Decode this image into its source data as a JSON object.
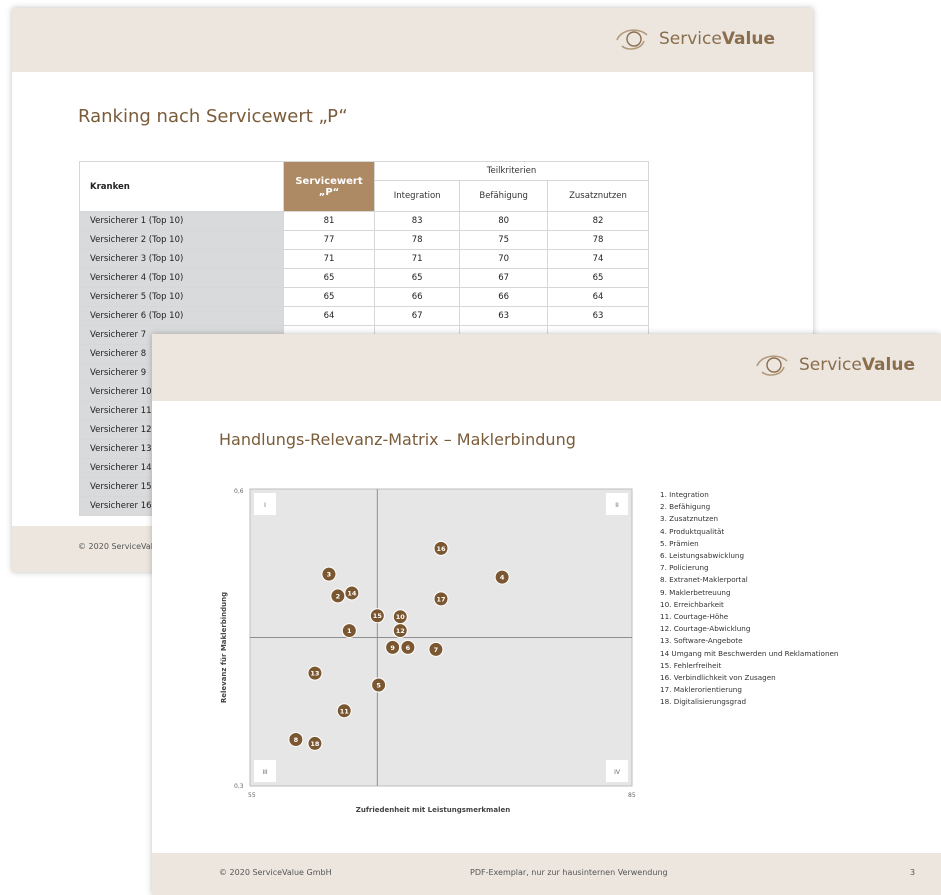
{
  "brand": {
    "name_light": "Service",
    "name_bold": "Value",
    "accent": "#ad8a63",
    "header_bg": "#ece6df",
    "row_bg": "#d9dadc",
    "matrix_bg": "#e6e6e6",
    "bubble": "#7a5730"
  },
  "slide1": {
    "title": "Ranking nach Servicewert „P“",
    "table": {
      "col_kranken": "Kranken",
      "col_servicewert": "Servicewert „P“",
      "col_teilkriterien": "Teilkriterien",
      "sub_cols": [
        "Integration",
        "Befähigung",
        "Zusatznutzen"
      ],
      "rows": [
        {
          "name": "Versicherer 1 (Top 10)",
          "values": [
            "81",
            "83",
            "80",
            "82"
          ]
        },
        {
          "name": "Versicherer 2 (Top 10)",
          "values": [
            "77",
            "78",
            "75",
            "78"
          ]
        },
        {
          "name": "Versicherer 3 (Top 10)",
          "values": [
            "71",
            "71",
            "70",
            "74"
          ]
        },
        {
          "name": "Versicherer 4 (Top 10)",
          "values": [
            "65",
            "65",
            "67",
            "65"
          ]
        },
        {
          "name": "Versicherer 5 (Top 10)",
          "values": [
            "65",
            "66",
            "66",
            "64"
          ]
        },
        {
          "name": "Versicherer 6 (Top 10)",
          "values": [
            "64",
            "67",
            "63",
            "63"
          ]
        },
        {
          "name": "Versicherer 7",
          "values": [
            "",
            "",
            "",
            ""
          ]
        },
        {
          "name": "Versicherer 8",
          "values": [
            "",
            "",
            "",
            ""
          ]
        },
        {
          "name": "Versicherer 9",
          "values": [
            "",
            "",
            "",
            ""
          ]
        },
        {
          "name": "Versicherer 10",
          "values": [
            "",
            "",
            "",
            ""
          ]
        },
        {
          "name": "Versicherer 11",
          "values": [
            "",
            "",
            "",
            ""
          ]
        },
        {
          "name": "Versicherer 12",
          "values": [
            "",
            "",
            "",
            ""
          ]
        },
        {
          "name": "Versicherer 13",
          "values": [
            "",
            "",
            "",
            ""
          ]
        },
        {
          "name": "Versicherer 14",
          "values": [
            "",
            "",
            "",
            ""
          ]
        },
        {
          "name": "Versicherer 15",
          "values": [
            "",
            "",
            "",
            ""
          ]
        },
        {
          "name": "Versicherer 16",
          "values": [
            "",
            "",
            "",
            ""
          ]
        }
      ]
    },
    "footer": "© 2020 ServiceVal"
  },
  "slide2": {
    "title": "Handlungs-Relevanz-Matrix  –  Maklerbindung",
    "footer_left": "© 2020 ServiceValue GmbH",
    "footer_center": "PDF-Exemplar, nur zur hausinternen Verwendung",
    "page_number": "3",
    "legend": [
      "1. Integration",
      "2. Befähigung",
      "3. Zusatznutzen",
      "4. Produktqualität",
      "5. Prämien",
      "6. Leistungsabwicklung",
      "7. Policierung",
      "8. Extranet-Maklerportal",
      "9. Maklerbetreuung",
      "10. Erreichbarkeit",
      "11. Courtage-Höhe",
      "12. Courtage-Abwicklung",
      "13. Software-Angebote",
      "14 Umgang mit Beschwerden und Reklamationen",
      "15. Fehlerfreiheit",
      "16. Verbindlichkeit von Zusagen",
      "17. Maklerorientierung",
      "18. Digitalisierungsgrad"
    ]
  },
  "chart_data": {
    "type": "scatter",
    "xlabel": "Zufriedenheit mit Leistungsmerkmalen",
    "ylabel": "Relevanz für Maklerbindung",
    "xlim": [
      55,
      85
    ],
    "ylim": [
      0.3,
      0.6
    ],
    "x_ticks": [
      "55",
      "85"
    ],
    "y_ticks": [
      "0,3",
      "0,6"
    ],
    "quadrants": [
      "I",
      "II",
      "III",
      "IV"
    ],
    "grid": false,
    "points": [
      {
        "label": "1",
        "x": 62.8,
        "y": 0.457
      },
      {
        "label": "2",
        "x": 61.9,
        "y": 0.492
      },
      {
        "label": "3",
        "x": 61.2,
        "y": 0.514
      },
      {
        "label": "4",
        "x": 74.8,
        "y": 0.511
      },
      {
        "label": "5",
        "x": 65.1,
        "y": 0.402
      },
      {
        "label": "6",
        "x": 67.4,
        "y": 0.44
      },
      {
        "label": "7",
        "x": 69.6,
        "y": 0.438
      },
      {
        "label": "8",
        "x": 58.6,
        "y": 0.347
      },
      {
        "label": "9",
        "x": 66.2,
        "y": 0.44
      },
      {
        "label": "10",
        "x": 66.8,
        "y": 0.471
      },
      {
        "label": "11",
        "x": 62.4,
        "y": 0.376
      },
      {
        "label": "12",
        "x": 66.8,
        "y": 0.457
      },
      {
        "label": "13",
        "x": 60.1,
        "y": 0.414
      },
      {
        "label": "14",
        "x": 63.0,
        "y": 0.495
      },
      {
        "label": "15",
        "x": 65.0,
        "y": 0.472
      },
      {
        "label": "16",
        "x": 70.0,
        "y": 0.54
      },
      {
        "label": "17",
        "x": 70.0,
        "y": 0.489
      },
      {
        "label": "18",
        "x": 60.1,
        "y": 0.343
      }
    ],
    "reference_lines": {
      "x": 65,
      "y": 0.45
    }
  }
}
